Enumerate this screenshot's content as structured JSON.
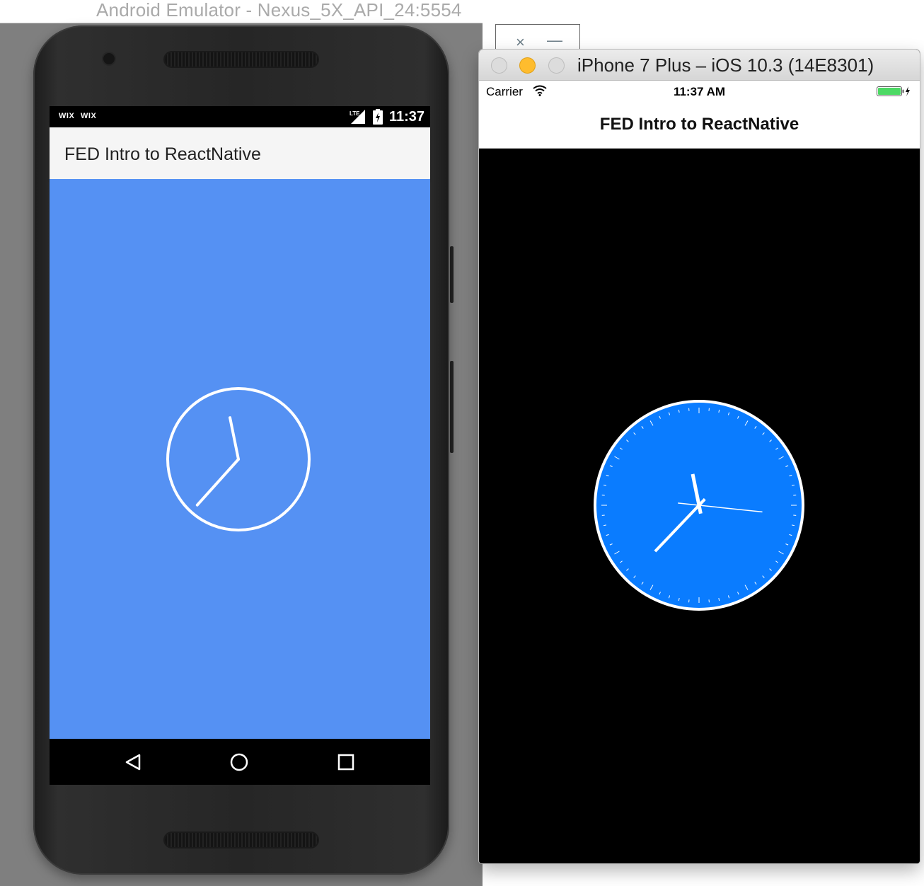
{
  "android_window": {
    "title": "Android Emulator - Nexus_5X_API_24:5554",
    "statusbar": {
      "left_icon_1": "WIX",
      "left_icon_2": "WIX",
      "network": "LTE",
      "time": "11:37"
    },
    "app_title": "FED Intro to ReactNative",
    "content_color": "#5591f3",
    "clock": {
      "hour": 11,
      "minute": 37
    },
    "nav_icons": [
      "back-icon",
      "home-icon",
      "recents-icon"
    ]
  },
  "background_window": {
    "close_glyph": "×",
    "minimize_glyph": "—"
  },
  "ios_window": {
    "title": "iPhone 7 Plus – iOS 10.3 (14E8301)",
    "statusbar": {
      "carrier": "Carrier",
      "time": "11:37 AM"
    },
    "nav_title": "FED Intro to ReactNative",
    "clock_face_color": "#0a7cff",
    "clock": {
      "hour": 11,
      "minute": 37,
      "second": 16
    }
  }
}
